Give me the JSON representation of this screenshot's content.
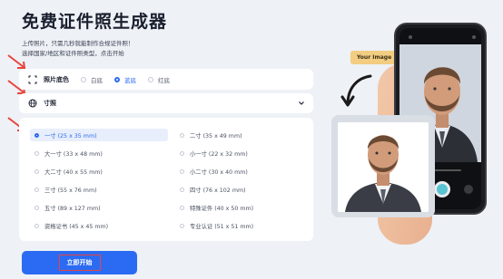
{
  "header": {
    "title": "免费证件照生成器",
    "subtitle_line1": "上传照片，只需几秒就能制作合规证件照！",
    "subtitle_line2": "选择国家/地区和证件照类型，点击开始"
  },
  "background": {
    "label": "照片底色",
    "options": [
      {
        "label": "白底",
        "selected": false
      },
      {
        "label": "蓝底",
        "selected": true
      },
      {
        "label": "红底",
        "selected": false
      }
    ]
  },
  "size_select": {
    "label": "寸照"
  },
  "sizes": [
    {
      "label": "一寸 (25 x 35 mm)",
      "selected": true
    },
    {
      "label": "二寸 (35 x 49 mm)",
      "selected": false
    },
    {
      "label": "大一寸 (33 x 48 mm)",
      "selected": false
    },
    {
      "label": "小一寸 (22 x 32 mm)",
      "selected": false
    },
    {
      "label": "大二寸 (40 x 55 mm)",
      "selected": false
    },
    {
      "label": "小二寸 (30 x 40 mm)",
      "selected": false
    },
    {
      "label": "三寸 (55 x 76 mm)",
      "selected": false
    },
    {
      "label": "四寸 (76 x 102 mm)",
      "selected": false
    },
    {
      "label": "五寸 (89 x 127 mm)",
      "selected": false
    },
    {
      "label": "特殊证件 (40 x 50 mm)",
      "selected": false
    },
    {
      "label": "资格证书 (45 x 45 mm)",
      "selected": false
    },
    {
      "label": "专业认证 (51 x 51 mm)",
      "selected": false
    }
  ],
  "start_button": {
    "label": "立即开始"
  },
  "preview": {
    "badge": "Your Image"
  },
  "colors": {
    "accent": "#2b6bf3",
    "arrow": "#e8453c",
    "badge": "#f2cd82",
    "blue_bg": "#dfe7f0"
  }
}
